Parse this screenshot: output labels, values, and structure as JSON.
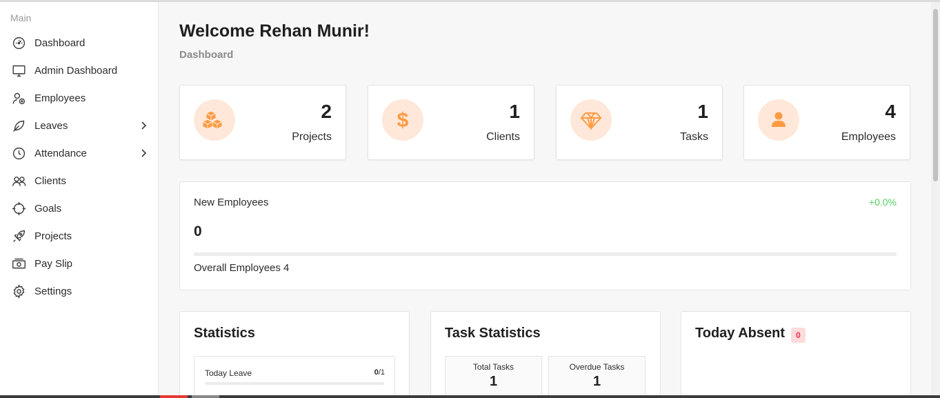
{
  "sidebar": {
    "section_title": "Main",
    "items": [
      {
        "label": "Dashboard",
        "icon": "dashboard-gauge-icon"
      },
      {
        "label": "Admin Dashboard",
        "icon": "monitor-icon"
      },
      {
        "label": "Employees",
        "icon": "user-add-icon"
      },
      {
        "label": "Leaves",
        "icon": "leaf-icon",
        "has_submenu": true
      },
      {
        "label": "Attendance",
        "icon": "clock-icon",
        "has_submenu": true
      },
      {
        "label": "Clients",
        "icon": "users-icon"
      },
      {
        "label": "Goals",
        "icon": "crosshair-icon"
      },
      {
        "label": "Projects",
        "icon": "rocket-icon"
      },
      {
        "label": "Pay Slip",
        "icon": "cash-icon"
      },
      {
        "label": "Settings",
        "icon": "gear-icon"
      }
    ]
  },
  "header": {
    "welcome": "Welcome Rehan Munir!",
    "breadcrumb": "Dashboard"
  },
  "stats": [
    {
      "value": "2",
      "label": "Projects",
      "icon": "cubes-icon"
    },
    {
      "value": "1",
      "label": "Clients",
      "icon": "dollar-icon"
    },
    {
      "value": "1",
      "label": "Tasks",
      "icon": "diamond-icon"
    },
    {
      "value": "4",
      "label": "Employees",
      "icon": "user-icon"
    }
  ],
  "new_employees": {
    "title": "New Employees",
    "change": "+0.0%",
    "count": "0",
    "progress": 0,
    "overall": "Overall Employees 4"
  },
  "statistics": {
    "title": "Statistics",
    "today_leave_label": "Today Leave",
    "today_leave_value": "0",
    "today_leave_total": "/1"
  },
  "task_statistics": {
    "title": "Task Statistics",
    "total_label": "Total Tasks",
    "total_value": "1",
    "overdue_label": "Overdue Tasks",
    "overdue_value": "1"
  },
  "today_absent": {
    "title": "Today Absent",
    "count": "0"
  },
  "colors": {
    "accent": "#ff9b44",
    "accent_light": "#ffe8d9",
    "success": "#55ce63",
    "danger": "#f62d51"
  }
}
